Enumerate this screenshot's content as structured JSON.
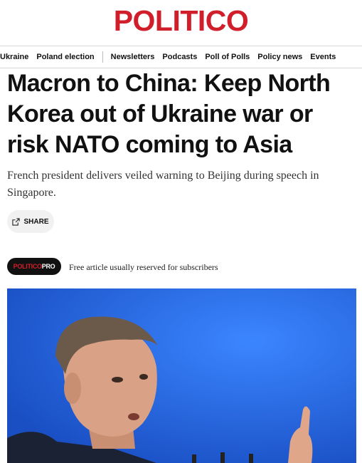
{
  "brand": {
    "logo_text": "POLITICO",
    "accent": "#d01f2a"
  },
  "nav": {
    "items_left": [
      "Ukraine",
      "Poland election"
    ],
    "items_right": [
      "Newsletters",
      "Podcasts",
      "Poll of Polls",
      "Policy news",
      "Events"
    ]
  },
  "article": {
    "headline": "Macron to China: Keep North Korea out of Ukraine war or risk NATO coming to Asia",
    "dek": "French president delivers veiled warning to Beijing during speech in Singapore.",
    "share_label": "SHARE",
    "pro_badge": {
      "part1": "POLITICO",
      "part2": "PRO"
    },
    "pro_note": "Free article usually reserved for subscribers"
  }
}
